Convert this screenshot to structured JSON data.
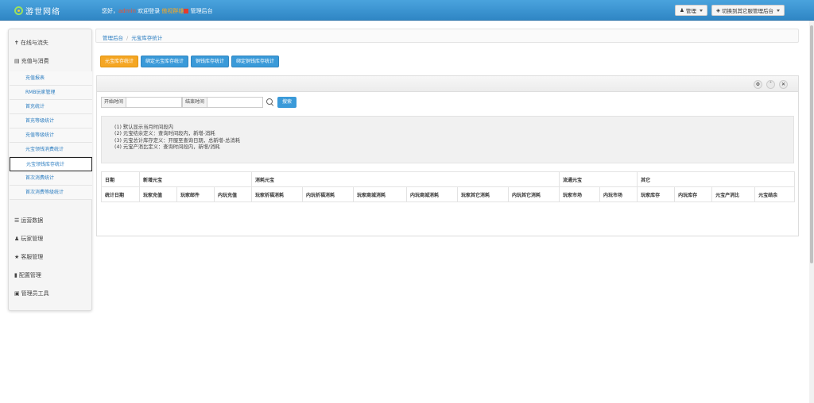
{
  "header": {
    "brand": "游世网络",
    "welcome_prefix": "您好，",
    "welcome_user": "admin",
    "welcome_mid": " 欢迎登录 ",
    "welcome_hi": "傲视群雄",
    "welcome_suffix": " 管理后台",
    "admin_btn": "管理",
    "switch_btn": "切换到其它服管理后台"
  },
  "sidebar": {
    "groups": [
      "在线与流失",
      "充值与消费",
      "运营数据",
      "玩家管理",
      "客服管理",
      "配置管理",
      "管理员工具"
    ],
    "subitems": [
      "充值报表",
      "RMB玩家管理",
      "首充统计",
      "首充等级统计",
      "充值等级统计",
      "元宝领钱消费统计",
      "元宝领钱库存统计",
      "首次消费统计",
      "首次消费等级统计"
    ]
  },
  "breadcrumb": {
    "root": "管理后台",
    "sep": "/",
    "current": "元宝库存统计"
  },
  "tabs": [
    "元宝库存统计",
    "绑定元宝库存统计",
    "铜钱库存统计",
    "绑定铜钱库存统计"
  ],
  "search": {
    "start_label": "开始时间",
    "end_label": "结束时间",
    "button": "搜索"
  },
  "notes": [
    "(1) 默认显示当月时间段内",
    "(2) 元宝结余定义：查询时间段内，新增-消耗",
    "(3) 元宝总计库存定义：开服至查询日期，总新增-总消耗",
    "(4) 元宝产消比定义：查询时间段内，新增/消耗"
  ],
  "table": {
    "group_headers": [
      "日期",
      "新增元宝",
      "消耗元宝",
      "流通元宝",
      "其它"
    ],
    "columns": [
      "统计日期",
      "玩家充值",
      "玩家邮件",
      "内玩充值",
      "玩家祈福消耗",
      "内玩祈福消耗",
      "玩家商城消耗",
      "内玩商城消耗",
      "玩家其它消耗",
      "内玩其它消耗",
      "玩家市场",
      "内玩市场",
      "玩家库存",
      "内玩库存",
      "元宝产消比",
      "元宝结余"
    ]
  }
}
